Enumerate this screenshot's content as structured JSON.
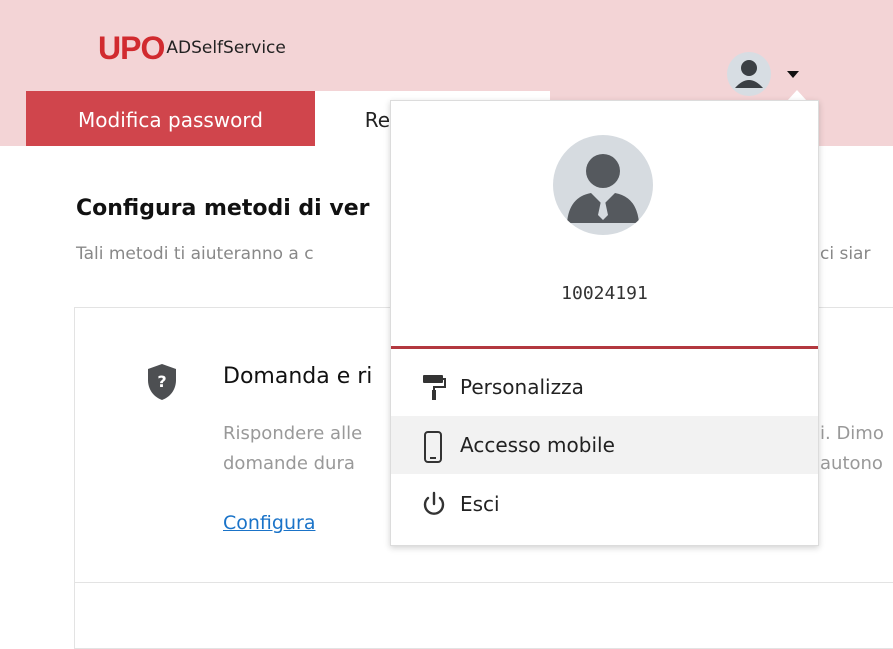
{
  "header": {
    "logo_mark": "UPO",
    "logo_text": "ADSelfService"
  },
  "tabs": [
    {
      "label": "Modifica password",
      "active": true
    },
    {
      "label": "Registrazione",
      "active": false
    }
  ],
  "main": {
    "title": "Configura metodi di ver",
    "subtitle": "Tali metodi ti aiuteranno a c",
    "subtitle_right": "ci siar",
    "card": {
      "title": "Domanda e ri",
      "description_line1": "Rispondere alle",
      "description_line2": "domande dura",
      "description_line1_right": "i. Dimo",
      "description_line2_right": "autono",
      "link_label": "Configura"
    }
  },
  "dropdown": {
    "username": "10024191",
    "items": [
      {
        "label": "Personalizza",
        "icon": "paint-roller-icon"
      },
      {
        "label": "Accesso mobile",
        "icon": "mobile-phone-icon"
      },
      {
        "label": "Esci",
        "icon": "power-icon"
      }
    ]
  },
  "colors": {
    "header_bg": "#f3d4d6",
    "tab_active_bg": "#d0454c",
    "accent": "#b3383f",
    "link": "#1a73c8"
  }
}
